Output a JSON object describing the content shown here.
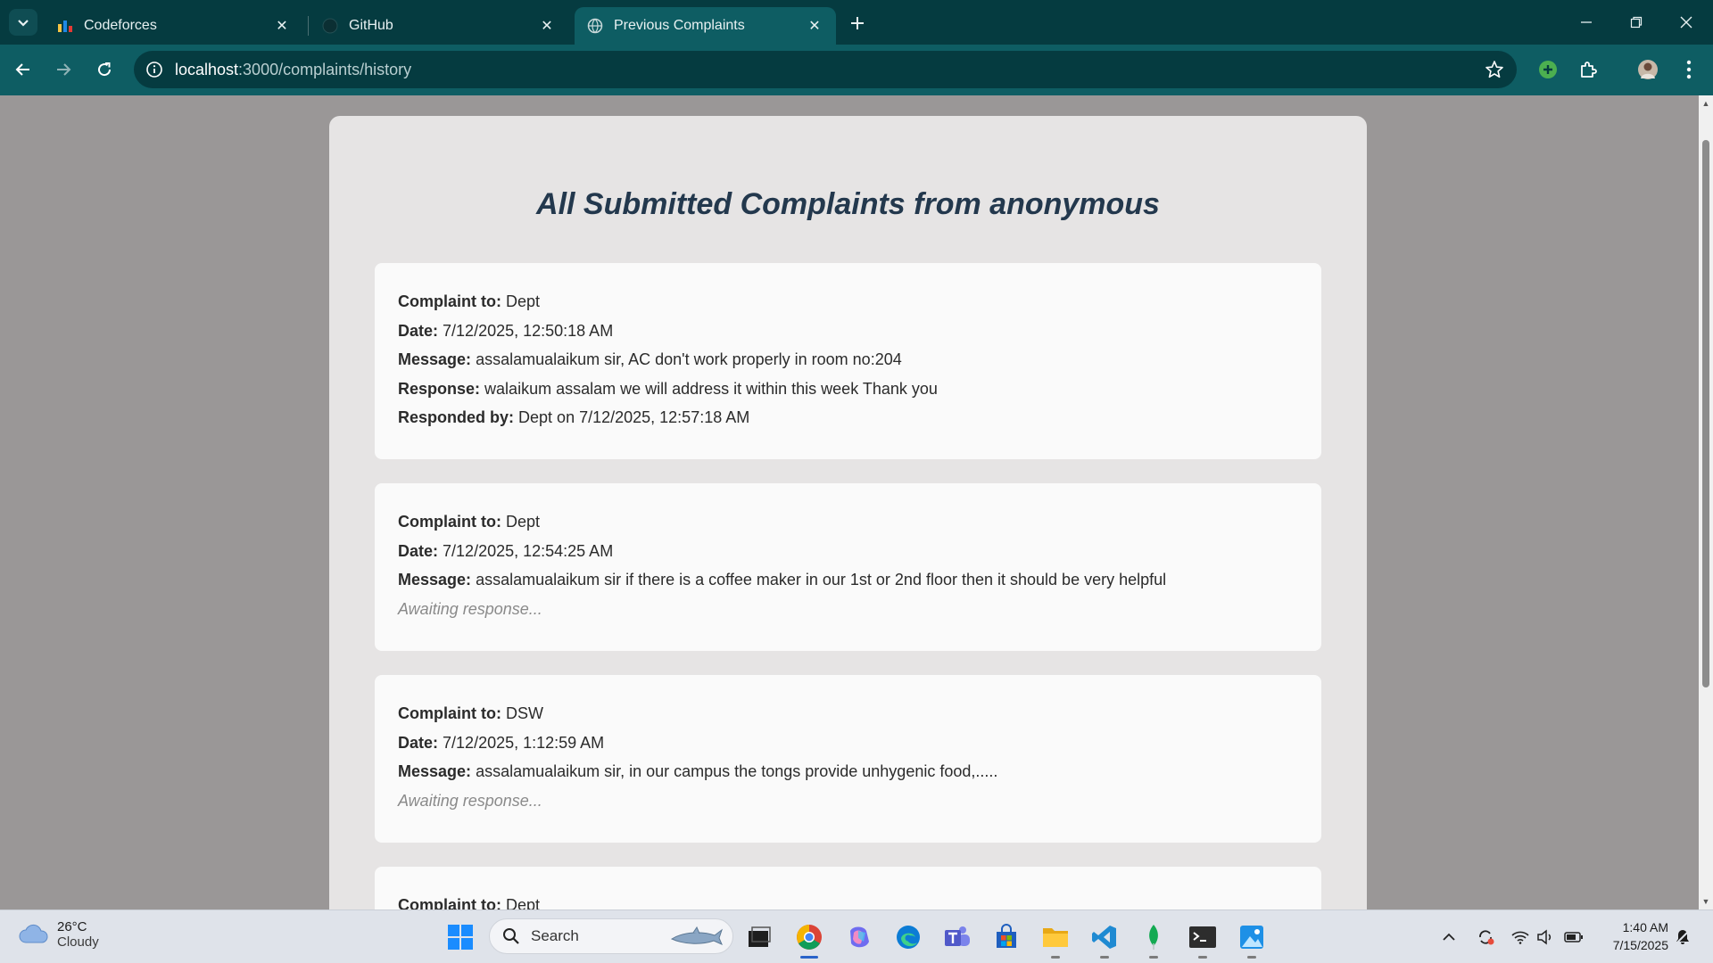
{
  "browser": {
    "tabs": [
      {
        "title": "Codeforces",
        "icon": "codeforces-icon"
      },
      {
        "title": "GitHub",
        "icon": "github-icon"
      },
      {
        "title": "Previous Complaints",
        "icon": "globe-icon"
      }
    ],
    "active_tab_index": 2,
    "address": {
      "host": "localhost",
      "path": ":3000/complaints/history"
    }
  },
  "page": {
    "title": "All Submitted Complaints from anonymous",
    "labels": {
      "complaint_to": "Complaint to:",
      "date": "Date:",
      "message": "Message:",
      "response": "Response:",
      "responded_by": "Responded by:",
      "awaiting": "Awaiting response..."
    },
    "complaints": [
      {
        "to": "Dept",
        "date": "7/12/2025, 12:50:18 AM",
        "message": "assalamualaikum sir, AC don't work properly in room no:204",
        "response": "walaikum assalam we will address it within this week Thank you",
        "responded_by": "Dept on 7/12/2025, 12:57:18 AM"
      },
      {
        "to": "Dept",
        "date": "7/12/2025, 12:54:25 AM",
        "message": "assalamualaikum sir if there is a coffee maker in our 1st or 2nd floor then it should be very helpful"
      },
      {
        "to": "DSW",
        "date": "7/12/2025, 1:12:59 AM",
        "message": "assalamualaikum sir, in our campus the tongs provide unhygenic food,....."
      },
      {
        "to": "Dept"
      }
    ]
  },
  "taskbar": {
    "weather": {
      "temp": "26°C",
      "condition": "Cloudy"
    },
    "search_label": "Search",
    "clock": {
      "time": "1:40 AM",
      "date": "7/15/2025"
    }
  },
  "colors": {
    "tabbar": "#053b40",
    "toolbar": "#0e5d63",
    "page_background": "#9a9797",
    "panel": "#e6e4e4",
    "card": "#fafafa",
    "title": "#23384d"
  }
}
